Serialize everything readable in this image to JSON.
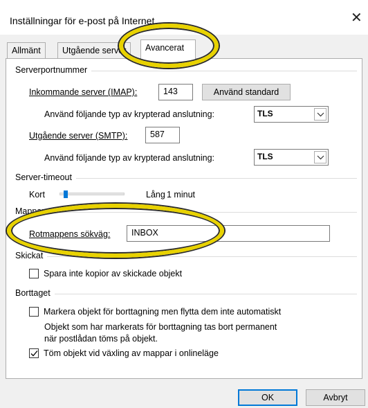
{
  "window": {
    "title": "Inställningar för e-post på Internet",
    "close_symbol": "✕"
  },
  "tabs": [
    {
      "label": "Allmänt",
      "active": false
    },
    {
      "label": "Utgående server",
      "active": false
    },
    {
      "label": "Avancerat",
      "active": true
    }
  ],
  "server_ports": {
    "group_title": "Serverportnummer",
    "incoming_label": "Inkommande server (IMAP):",
    "incoming_value": "143",
    "use_default_button": "Använd standard",
    "incoming_encryption_label": "Använd följande typ av krypterad anslutning:",
    "incoming_encryption_value": "TLS",
    "outgoing_label": "Utgående server (SMTP):",
    "outgoing_value": "587",
    "outgoing_encryption_label": "Använd följande typ av krypterad anslutning:",
    "outgoing_encryption_value": "TLS"
  },
  "server_timeout": {
    "group_title": "Server-timeout",
    "short_label": "Kort",
    "long_label": "Lång",
    "value": "1 minut",
    "slider_fraction": 0.1
  },
  "folders": {
    "group_title": "Mappar",
    "root_path_label": "Rotmappens sökväg:",
    "root_path_value": "INBOX"
  },
  "sent_items": {
    "group_title": "Skickat",
    "no_copies_label": "Spara inte kopior av skickade objekt",
    "no_copies_checked": false
  },
  "deleted_items": {
    "group_title": "Borttaget",
    "mark_label": "Markera objekt för borttagning men flytta dem inte automatiskt",
    "mark_checked": false,
    "info_line1": "Objekt som har markerats för borttagning tas bort permanent",
    "info_line2": "när postlådan töms på objekt.",
    "purge_label": "Töm objekt vid växling av mappar i onlineläge",
    "purge_checked": true
  },
  "buttons": {
    "ok": "OK",
    "cancel": "Avbryt"
  },
  "colors": {
    "highlight": "#e8d200",
    "accent": "#0078d7"
  }
}
